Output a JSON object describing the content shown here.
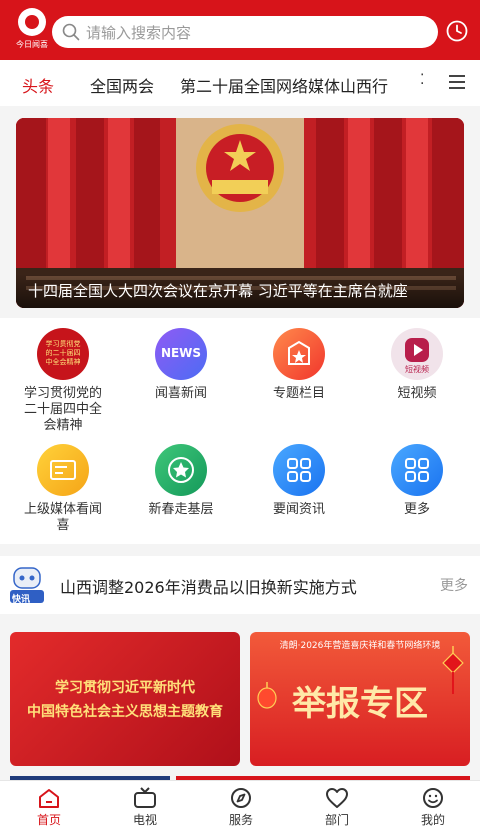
{
  "app": {
    "logo_text": "今日闻喜"
  },
  "search": {
    "placeholder": "请输入搜索内容"
  },
  "tabs": [
    {
      "label": "头条",
      "active": true
    },
    {
      "label": "全国两会",
      "active": false
    },
    {
      "label": "第二十届全国网络媒体山西行",
      "active": false
    }
  ],
  "banner": {
    "caption": "十四届全国人大四次会议在京开幕 习近平等在主席台就座"
  },
  "grid": [
    {
      "label": "学习贯彻党的二十届四中全会精神",
      "icon": "study-badge-icon",
      "badge_text": "学习贯彻党的二十届四中全会精神"
    },
    {
      "label": "闻喜新闻",
      "icon": "news-icon",
      "badge_text": "NEWS"
    },
    {
      "label": "专题栏目",
      "icon": "topic-icon"
    },
    {
      "label": "短视频",
      "icon": "short-video-icon",
      "badge_text": "短视频"
    },
    {
      "label": "上级媒体看闻喜",
      "icon": "ticket-icon"
    },
    {
      "label": "新春走基层",
      "icon": "star-icon"
    },
    {
      "label": "要闻资讯",
      "icon": "apps-icon"
    },
    {
      "label": "更多",
      "icon": "more-apps-icon"
    }
  ],
  "news_ticker": {
    "badge": "快讯",
    "text": "山西调整2026年消费品以旧换新实施方式",
    "more": "更多"
  },
  "promos": [
    {
      "line1": "学习贯彻习近平新时代",
      "line2": "中国特色社会主义思想主题教育"
    },
    {
      "subtitle": "清朗·2026年营造喜庆祥和春节网络环境",
      "title": "举报专区"
    }
  ],
  "bottom_nav": [
    {
      "label": "首页",
      "active": true
    },
    {
      "label": "电视",
      "active": false
    },
    {
      "label": "服务",
      "active": false
    },
    {
      "label": "部门",
      "active": false
    },
    {
      "label": "我的",
      "active": false
    }
  ],
  "colors": {
    "brand": "#d7141a"
  }
}
